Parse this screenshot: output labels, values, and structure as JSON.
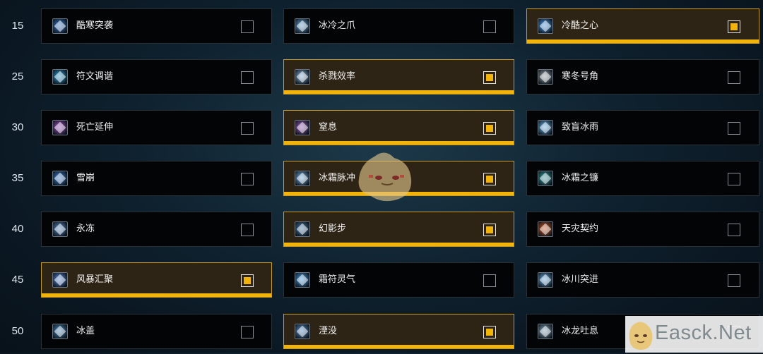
{
  "accent_color": "#f3b40a",
  "rows": [
    {
      "level": "15",
      "talents": [
        {
          "name": "酷寒突袭",
          "selected": false,
          "icon": "frost-strike-icon",
          "icon_color": "#3a7ad0"
        },
        {
          "name": "冰冷之爪",
          "selected": false,
          "icon": "frost-claw-icon",
          "icon_color": "#6aa6d8"
        },
        {
          "name": "冷酷之心",
          "selected": true,
          "icon": "cold-heart-icon",
          "icon_color": "#4a9ef0"
        }
      ]
    },
    {
      "level": "25",
      "talents": [
        {
          "name": "符文调谐",
          "selected": false,
          "icon": "rune-attunement-icon",
          "icon_color": "#2f9ed8"
        },
        {
          "name": "杀戮效率",
          "selected": true,
          "icon": "killing-efficiency-icon",
          "icon_color": "#8ab4dc"
        },
        {
          "name": "寒冬号角",
          "selected": false,
          "icon": "horn-of-winter-icon",
          "icon_color": "#9aa4ac"
        }
      ]
    },
    {
      "level": "30",
      "talents": [
        {
          "name": "死亡延伸",
          "selected": false,
          "icon": "death-pact-icon",
          "icon_color": "#a04ec0"
        },
        {
          "name": "窒息",
          "selected": true,
          "icon": "asphyxiate-icon",
          "icon_color": "#9a5ab8"
        },
        {
          "name": "致盲冰雨",
          "selected": false,
          "icon": "blinding-sleet-icon",
          "icon_color": "#6ab8f0"
        }
      ]
    },
    {
      "level": "35",
      "talents": [
        {
          "name": "雪崩",
          "selected": false,
          "icon": "avalanche-icon",
          "icon_color": "#3e80d8"
        },
        {
          "name": "冰霜脉冲",
          "selected": true,
          "icon": "frost-pulse-icon",
          "icon_color": "#7ab0e0"
        },
        {
          "name": "冰霜之镰",
          "selected": false,
          "icon": "frostscythe-icon",
          "icon_color": "#3aa0a8"
        }
      ]
    },
    {
      "level": "40",
      "talents": [
        {
          "name": "永冻",
          "selected": false,
          "icon": "permafrost-icon",
          "icon_color": "#5a8ac8"
        },
        {
          "name": "幻影步",
          "selected": true,
          "icon": "wraith-walk-icon",
          "icon_color": "#4a7aa8"
        },
        {
          "name": "天灾契约",
          "selected": false,
          "icon": "death-pact-fire-icon",
          "icon_color": "#d05a28"
        }
      ]
    },
    {
      "level": "45",
      "talents": [
        {
          "name": "风暴汇聚",
          "selected": true,
          "icon": "gathering-storm-icon",
          "icon_color": "#5a8ae0"
        },
        {
          "name": "霜符灵气",
          "selected": false,
          "icon": "frost-rune-aura-icon",
          "icon_color": "#4aa0e8"
        },
        {
          "name": "冰川突进",
          "selected": false,
          "icon": "glacial-advance-icon",
          "icon_color": "#6ab0e8"
        }
      ]
    },
    {
      "level": "50",
      "talents": [
        {
          "name": "冰盖",
          "selected": false,
          "icon": "icecap-icon",
          "icon_color": "#4a8ac0"
        },
        {
          "name": "湮没",
          "selected": true,
          "icon": "obliteration-icon",
          "icon_color": "#5a90c8"
        },
        {
          "name": "冰龙吐息",
          "selected": false,
          "icon": "breath-of-sindragosa-icon",
          "icon_color": "#8aa8c0"
        }
      ]
    }
  ],
  "watermark": {
    "text": "Easck.Net"
  }
}
